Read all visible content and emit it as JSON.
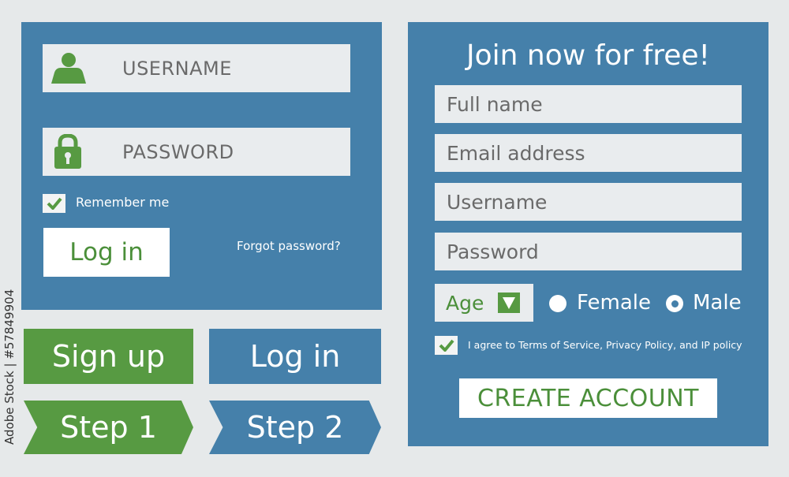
{
  "login": {
    "username_placeholder": "USERNAME",
    "password_placeholder": "PASSWORD",
    "remember_label": "Remember me",
    "login_button": "Log in",
    "forgot_link": "Forgot password?"
  },
  "buttons": {
    "signup": "Sign up",
    "login": "Log in",
    "step1": "Step 1",
    "step2": "Step 2"
  },
  "signup": {
    "title": "Join now for free!",
    "fullname_placeholder": "Full name",
    "email_placeholder": "Email address",
    "username_placeholder": "Username",
    "password_placeholder": "Password",
    "age_label": "Age",
    "female_label": "Female",
    "male_label": "Male",
    "selected_gender": "Male",
    "agree_label": "I agree to Terms of Service, Privacy Policy, and IP policy",
    "agree_checked": true,
    "create_button": "CREATE ACCOUNT"
  },
  "stock_id": "Adobe Stock | #57849904",
  "colors": {
    "panel_blue": "#4580aa",
    "accent_green": "#579a42",
    "field_bg": "#e9ecee",
    "page_bg": "#e6e9ea"
  },
  "icons": [
    "user-icon",
    "lock-icon",
    "checkmark-icon",
    "triangle-down-icon"
  ]
}
